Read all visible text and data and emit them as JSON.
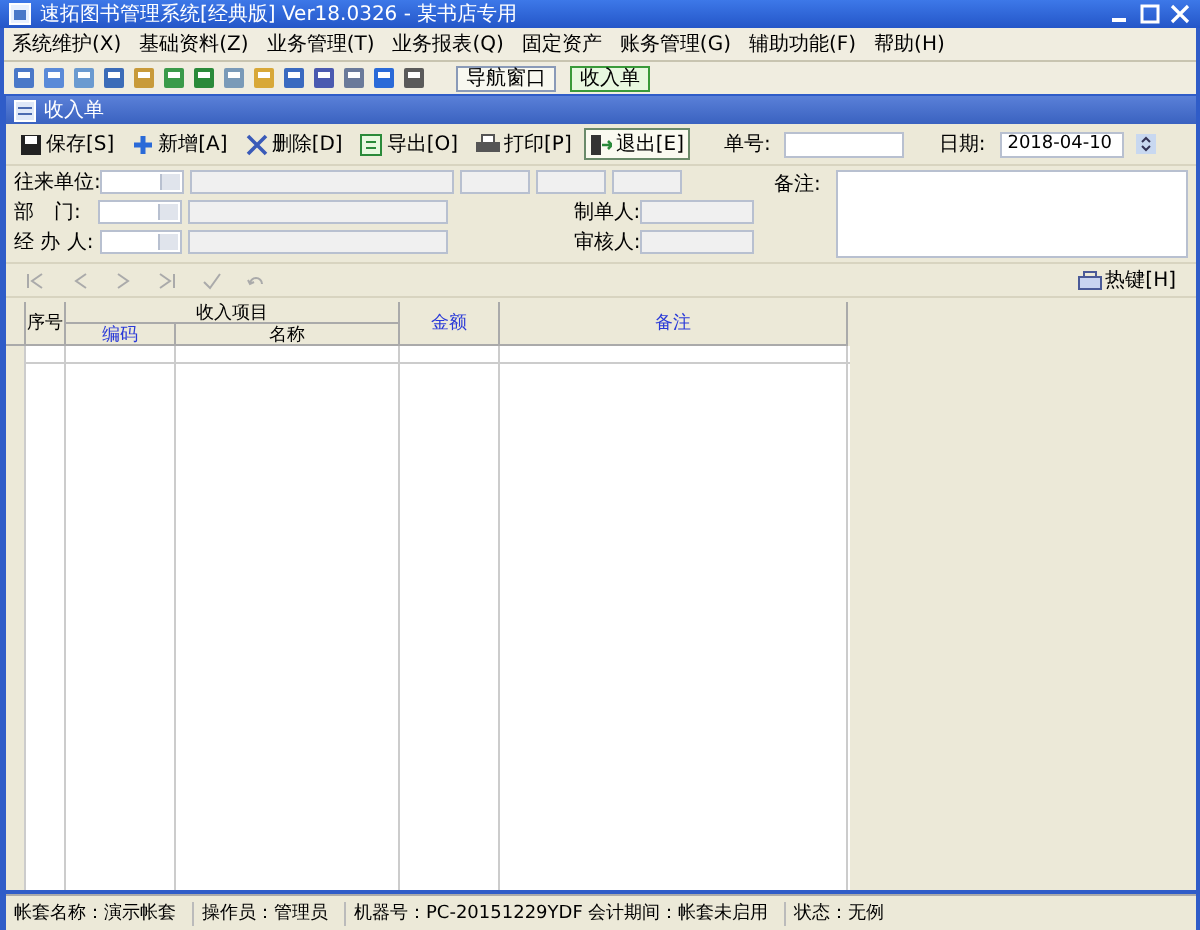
{
  "window": {
    "title": "速拓图书管理系统[经典版] Ver18.0326 - 某书店专用"
  },
  "menu": [
    "系统维护(X)",
    "基础资料(Z)",
    "业务管理(T)",
    "业务报表(Q)",
    "固定资产",
    "账务管理(G)",
    "辅助功能(F)",
    "帮助(H)"
  ],
  "window_tabs": [
    {
      "label": "导航窗口",
      "selected": false
    },
    {
      "label": "收入单",
      "selected": true
    }
  ],
  "document": {
    "title": "收入单"
  },
  "actions": [
    {
      "kind": "save",
      "label": "保存[S]"
    },
    {
      "kind": "add",
      "label": "新增[A]"
    },
    {
      "kind": "delete",
      "label": "删除[D]"
    },
    {
      "kind": "export",
      "label": "导出[O]"
    },
    {
      "kind": "print",
      "label": "打印[P]"
    },
    {
      "kind": "exit",
      "label": "退出[E]"
    }
  ],
  "form": {
    "number_label": "单号:",
    "date_label": "日期:",
    "date": "2018-04-10",
    "counterparty_label": "往来单位:",
    "department_label": "部　门:",
    "handler_label": "经 办 人:",
    "maker_label": "制单人:",
    "reviewer_label": "审核人:",
    "remark_label": "备注:"
  },
  "hotkey": "热键[H]",
  "table": {
    "columns": {
      "index": "序号",
      "group": "收入项目",
      "code": "编码",
      "name": "名称",
      "amount": "金额",
      "remark": "备注"
    }
  },
  "status_bar": [
    "帐套名称：演示帐套",
    "操作员：管理员",
    "机器号：PC-20151229YDF 会计期间：帐套未启用",
    "状态：无例"
  ]
}
